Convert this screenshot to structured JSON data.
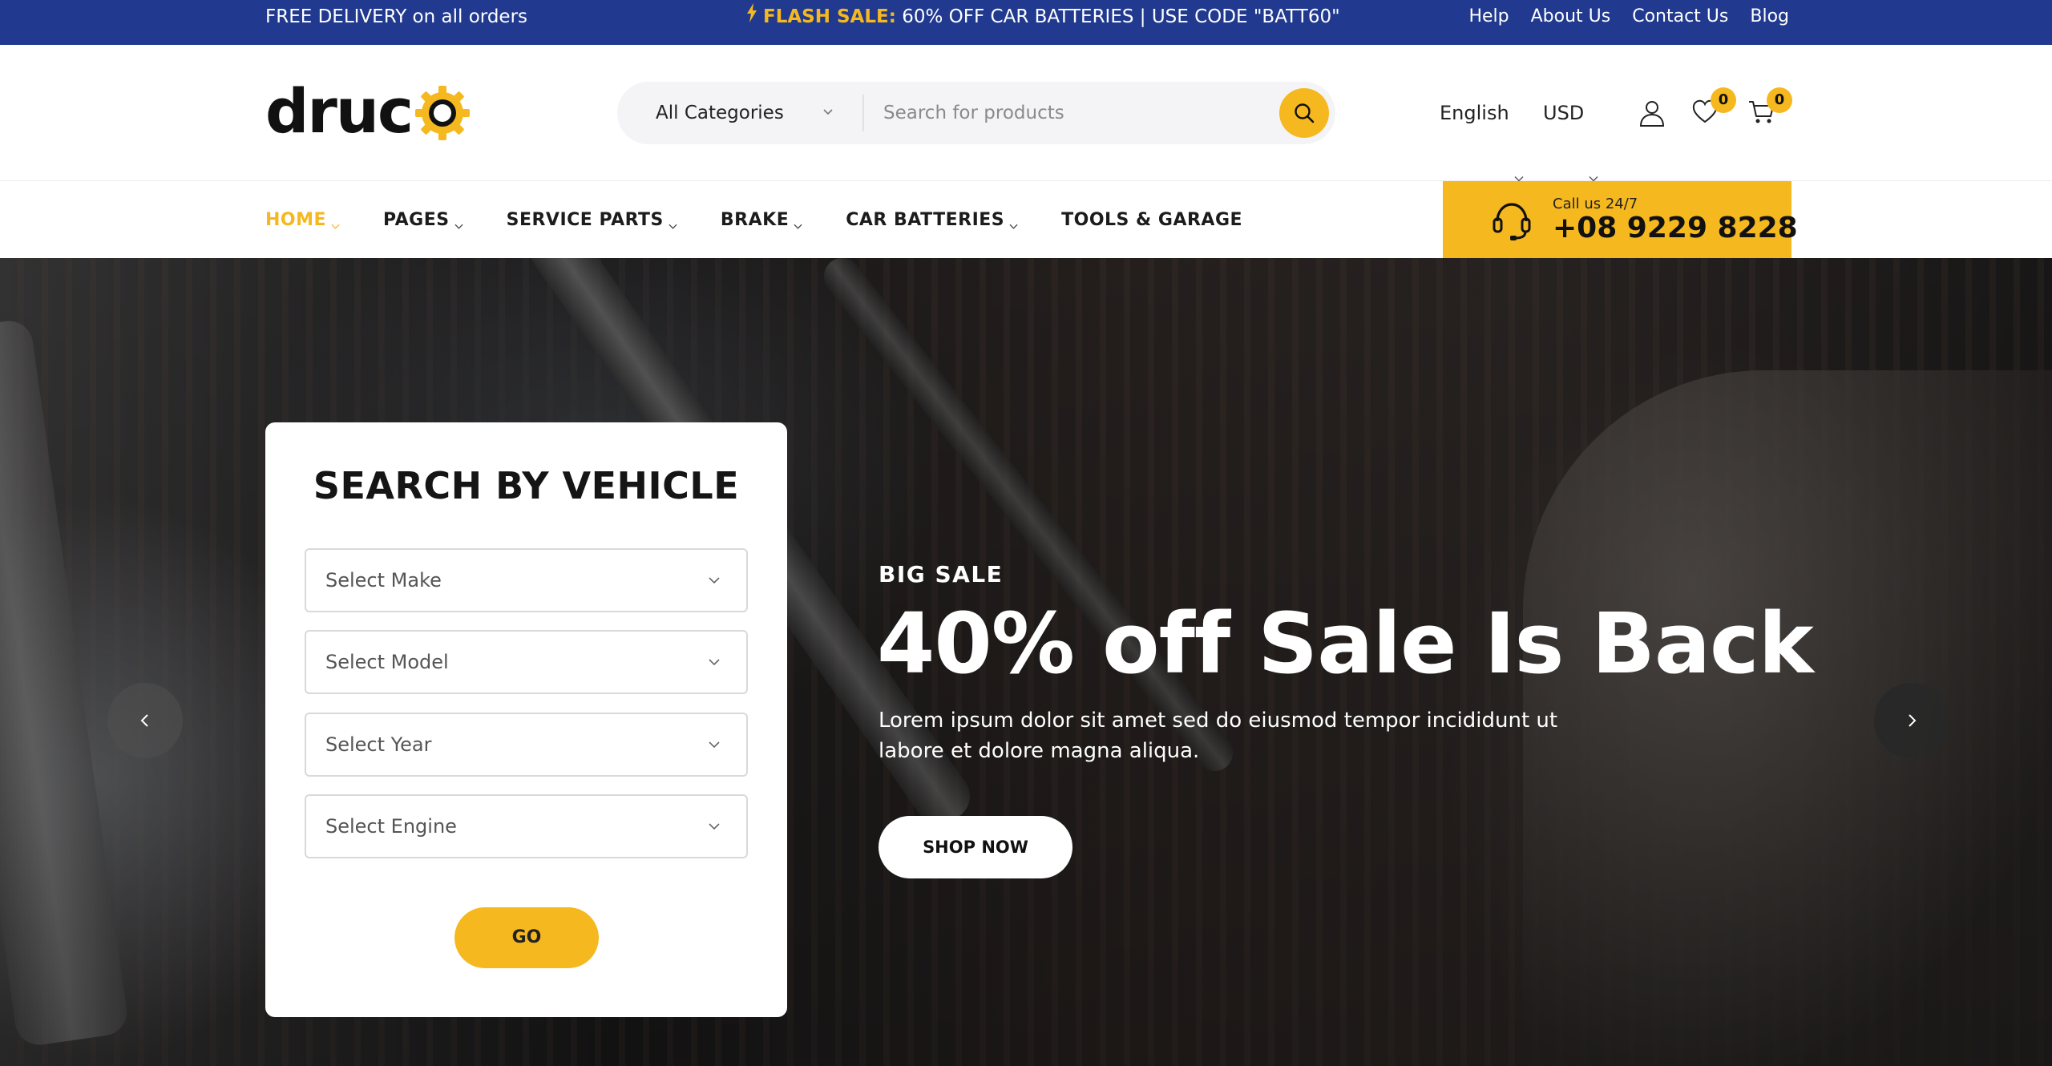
{
  "topbar": {
    "delivery": "FREE DELIVERY on all orders",
    "flash_label": "FLASH SALE:",
    "flash_text": " 60% OFF CAR BATTERIES | USE CODE \"BATT60\"",
    "links": [
      "Help",
      "About Us",
      "Contact Us",
      "Blog"
    ]
  },
  "header": {
    "logo_text": "druc",
    "logo_gear_letter": "o",
    "search": {
      "category": "All Categories",
      "placeholder": "Search for products"
    },
    "language": "English",
    "currency": "USD",
    "wishlist_count": "0",
    "cart_count": "0"
  },
  "nav": {
    "items": [
      {
        "label": "HOME",
        "active": true
      },
      {
        "label": "PAGES"
      },
      {
        "label": "SERVICE PARTS"
      },
      {
        "label": "BRAKE"
      },
      {
        "label": "CAR BATTERIES"
      },
      {
        "label": "TOOLS & GARAGE"
      }
    ],
    "call_small": "Call us 24/7",
    "call_number": "+08 9229 8228"
  },
  "vehicle_search": {
    "title": "SEARCH BY VEHICLE",
    "make": "Select Make",
    "model": "Select Model",
    "year": "Select Year",
    "engine": "Select Engine",
    "go": "GO"
  },
  "hero": {
    "kicker": "BIG SALE",
    "title": "40% off Sale Is Back",
    "desc_line1": "Lorem ipsum dolor sit amet sed do eiusmod tempor incididunt ut",
    "desc_line2": "labore et dolore magna aliqua.",
    "button": "SHOP NOW"
  },
  "colors": {
    "topbar_bg": "#213a8f",
    "accent": "#f6b81f"
  },
  "icons": [
    "bolt-icon",
    "gear-logo-icon",
    "chevron-down-icon",
    "search-icon",
    "user-icon",
    "heart-icon",
    "cart-icon",
    "headset-icon",
    "chevron-left-icon",
    "chevron-right-icon"
  ]
}
